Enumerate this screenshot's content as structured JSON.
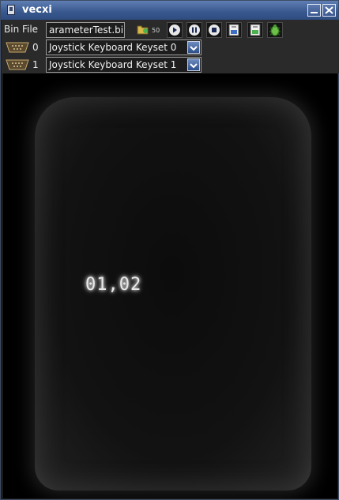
{
  "window": {
    "title": "vecxi"
  },
  "toolbar": {
    "bin_label": "Bin File",
    "bin_value": "arameterTest.bin",
    "speed_value": "50",
    "buttons": [
      {
        "icon": "open-file-icon"
      },
      {
        "icon": "play-icon"
      },
      {
        "icon": "pause-icon"
      },
      {
        "icon": "stop-icon"
      },
      {
        "icon": "save-state-icon"
      },
      {
        "icon": "load-state-icon"
      },
      {
        "icon": "debug-bug-icon"
      }
    ]
  },
  "players": [
    {
      "index": "0",
      "keyset": "Joystick Keyboard Keyset 0"
    },
    {
      "index": "1",
      "keyset": "Joystick Keyboard Keyset 1"
    }
  ],
  "screen": {
    "text": "01,02"
  },
  "colors": {
    "titlebar": "#3a5a90",
    "accent_arrow": "#2e4f8a",
    "toolbar_bg": "#2a2a2a"
  }
}
